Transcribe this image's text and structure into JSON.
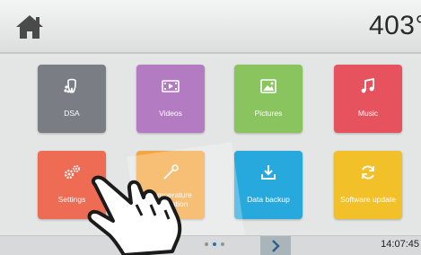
{
  "header": {
    "home_icon": "home-icon",
    "temperature": "403°"
  },
  "tiles": [
    {
      "label": "DSA",
      "icon": "dsa-icon",
      "color": "#7a7d84"
    },
    {
      "label": "Videos",
      "icon": "video-icon",
      "color": "#b37cc2"
    },
    {
      "label": "Pictures",
      "icon": "picture-icon",
      "color": "#8ac45e"
    },
    {
      "label": "Music",
      "icon": "music-icon",
      "color": "#e6525e"
    },
    {
      "label": "Settings",
      "icon": "settings-gears-icon",
      "color": "#ee6b54"
    },
    {
      "label": "Temperature calibration",
      "icon": "temperature-calibration-icon",
      "color": "#f4a542"
    },
    {
      "label": "Data backup",
      "icon": "data-backup-icon",
      "color": "#28a9de"
    },
    {
      "label": "Software update",
      "icon": "software-update-icon",
      "color": "#f2c029"
    }
  ],
  "footer": {
    "next_icon": "chevron-right-icon",
    "page_indicator": {
      "total": 3,
      "active": 2
    },
    "time": "14:07:45"
  }
}
